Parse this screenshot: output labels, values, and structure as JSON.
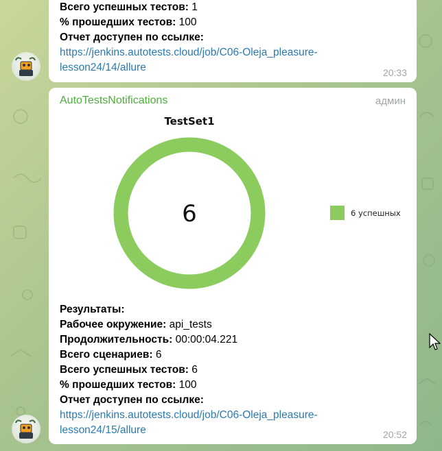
{
  "messages": [
    {
      "lines": [
        {
          "label": "Всего успешных тестов:",
          "value": " 1"
        },
        {
          "label": "% прошедших тестов:",
          "value": " 100"
        },
        {
          "label": "Отчет доступен по ссылке:",
          "value": ""
        }
      ],
      "link_line1": "https://jenkins.autotests.cloud/job/C06-Oleja_pleasure-",
      "link_line2": "lesson24/14/allure",
      "time": "20:33"
    },
    {
      "sender": "AutoTestsNotifications",
      "role": "админ",
      "lines": [
        {
          "label": "Результаты:",
          "value": ""
        },
        {
          "label": "Рабочее окружение:",
          "value": " api_tests"
        },
        {
          "label": "Продолжительность:",
          "value": " 00:00:04.221"
        },
        {
          "label": "Всего сценариев:",
          "value": " 6"
        },
        {
          "label": "Всего успешных тестов:",
          "value": " 6"
        },
        {
          "label": "% прошедших тестов:",
          "value": " 100"
        },
        {
          "label": "Отчет доступен по ссылке:",
          "value": ""
        }
      ],
      "link_line1": "https://jenkins.autotests.cloud/job/C06-Oleja_pleasure-",
      "link_line2": "lesson24/15/allure",
      "time": "20:52"
    }
  ],
  "chart_data": {
    "type": "pie",
    "title": "TestSet1",
    "center_label": "6",
    "slices": [
      {
        "name": "6 успешных",
        "value": 6,
        "color": "#8ccb5e"
      }
    ],
    "legend": "right"
  },
  "colors": {
    "accent": "#4eae3c",
    "link": "#2a7ab0",
    "passed": "#8ccb5e"
  }
}
